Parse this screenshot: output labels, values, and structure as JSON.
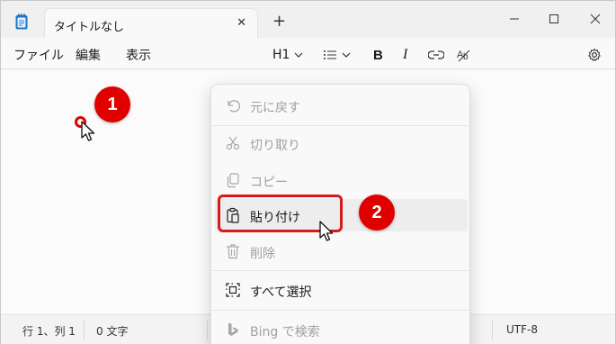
{
  "window": {
    "tab_title": "タイトルなし",
    "new_tab": "+",
    "close_tab": "✕"
  },
  "menubar": {
    "items": [
      "ファイル",
      "編集",
      "表示"
    ]
  },
  "toolbar": {
    "heading_label": "H1",
    "bold_label": "B",
    "italic_label": "I"
  },
  "context_menu": {
    "items": [
      {
        "label": "元に戻す",
        "icon": "undo-icon",
        "enabled": false
      },
      {
        "label": "切り取り",
        "icon": "cut-icon",
        "enabled": false
      },
      {
        "label": "コピー",
        "icon": "copy-icon",
        "enabled": false
      },
      {
        "label": "貼り付け",
        "icon": "paste-icon",
        "enabled": true,
        "highlighted": true
      },
      {
        "label": "削除",
        "icon": "delete-icon",
        "enabled": false
      },
      {
        "label": "すべて選択",
        "icon": "select-all-icon",
        "enabled": true
      },
      {
        "label": "Bing で検索",
        "icon": "bing-icon",
        "enabled": false
      }
    ]
  },
  "statusbar": {
    "position": "行 1、列 1",
    "chars": "0 文字",
    "encoding": "UTF-8"
  },
  "annotations": {
    "step1": "1",
    "step2": "2",
    "accent_color": "#e00000"
  }
}
